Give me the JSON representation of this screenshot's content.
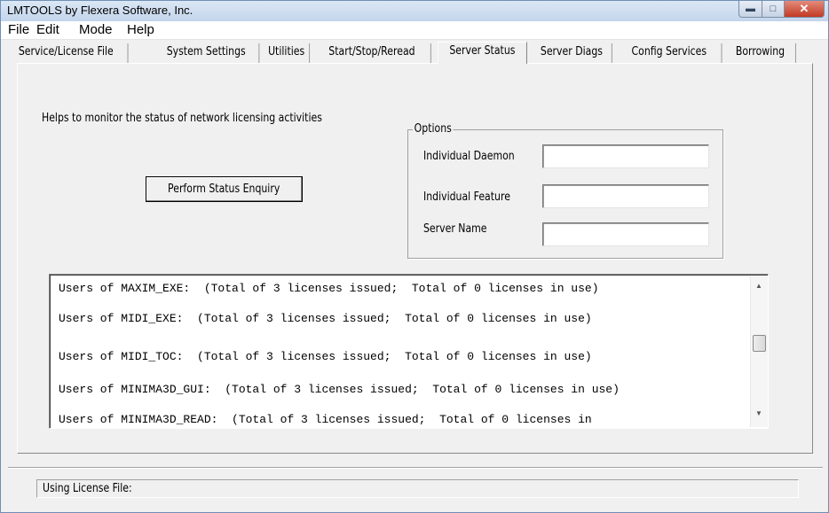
{
  "window": {
    "title": "LMTOOLS by Flexera Software, Inc."
  },
  "menu": [
    "File",
    "Edit",
    "Mode",
    "Help"
  ],
  "tabs": [
    "Service/License File",
    "System Settings",
    "Utilities",
    "Start/Stop/Reread",
    "Server Status",
    "Server Diags",
    "Config Services",
    "Borrowing"
  ],
  "active_tab": "Server Status",
  "server_status": {
    "help_text": "Helps to monitor the status of network licensing activities",
    "perform_button": "Perform Status Enquiry",
    "options": {
      "group_label": "Options",
      "daemon_label": "Individual Daemon",
      "feature_label": "Individual Feature",
      "server_label": "Server Name",
      "daemon_value": "",
      "feature_value": "",
      "server_value": ""
    },
    "output_lines": [
      "Users of MAXIM_EXE:  (Total of 3 licenses issued;  Total of 0 licenses in use)",
      "Users of MIDI_EXE:  (Total of 3 licenses issued;  Total of 0 licenses in use)",
      "Users of MIDI_TOC:  (Total of 3 licenses issued;  Total of 0 licenses in use)",
      "Users of MINIMA3D_GUI:  (Total of 3 licenses issued;  Total of 0 licenses in use)",
      "Users of MINIMA3D_READ:  (Total of 3 licenses issued;  Total of 0 licenses in"
    ]
  },
  "status_bar": {
    "text": "Using License File:"
  }
}
